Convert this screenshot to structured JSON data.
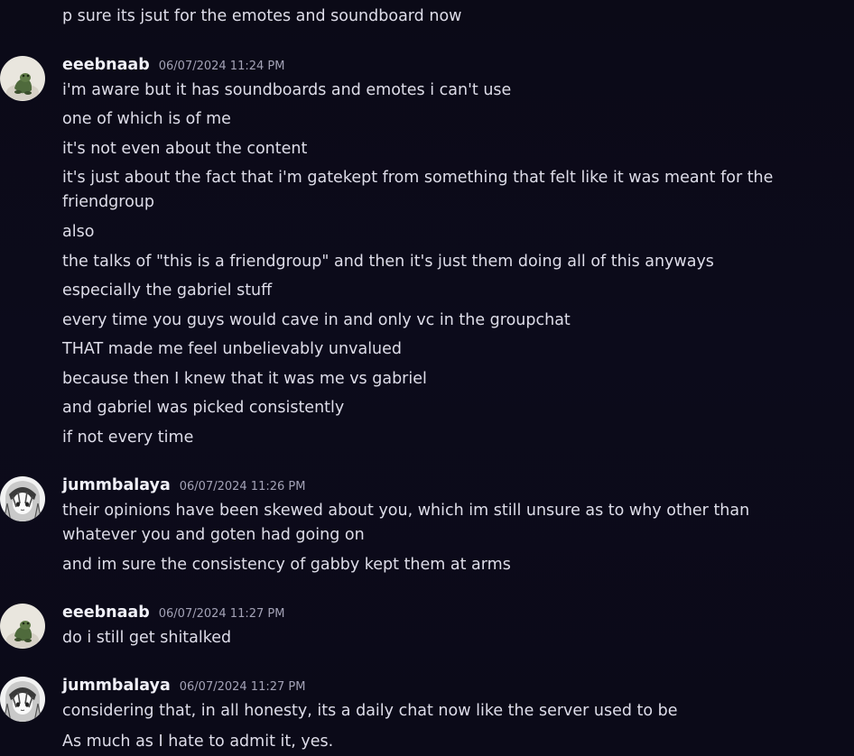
{
  "messages": [
    {
      "continued": true,
      "lines": [
        "p sure its jsut for the emotes and soundboard now"
      ]
    },
    {
      "username": "eeebnaab",
      "timestamp": "06/07/2024 11:24 PM",
      "avatar_icon": "frog-figure-avatar",
      "lines": [
        "i'm aware but it has soundboards and emotes i can't use",
        "one of which is of me",
        "it's not even about the content",
        "it's just about the fact that i'm gatekept from something that felt like it was meant for the friendgroup",
        "also",
        "the talks of \"this is a friendgroup\" and then it's just them doing all of this anyways",
        "especially the gabriel stuff",
        "every time you guys would cave in and only vc in the groupchat",
        "THAT made me feel unbelievably unvalued",
        "because then I knew that it was me vs gabriel",
        "and gabriel was picked consistently",
        "if not every time"
      ]
    },
    {
      "username": "jummbalaya",
      "timestamp": "06/07/2024 11:26 PM",
      "avatar_icon": "anime-girl-avatar",
      "lines": [
        "their opinions have been skewed about you, which im still unsure as to why other than whatever you and goten had going on",
        "and im sure the consistency of gabby kept them at arms"
      ]
    },
    {
      "username": "eeebnaab",
      "timestamp": "06/07/2024 11:27 PM",
      "avatar_icon": "frog-figure-avatar",
      "lines": [
        "do i still get shitalked"
      ]
    },
    {
      "username": "jummbalaya",
      "timestamp": "06/07/2024 11:27 PM",
      "avatar_icon": "anime-girl-avatar",
      "lines": [
        "considering that, in all honesty, its a daily chat now like the server used to be",
        "As much as I hate to admit it, yes."
      ]
    }
  ]
}
